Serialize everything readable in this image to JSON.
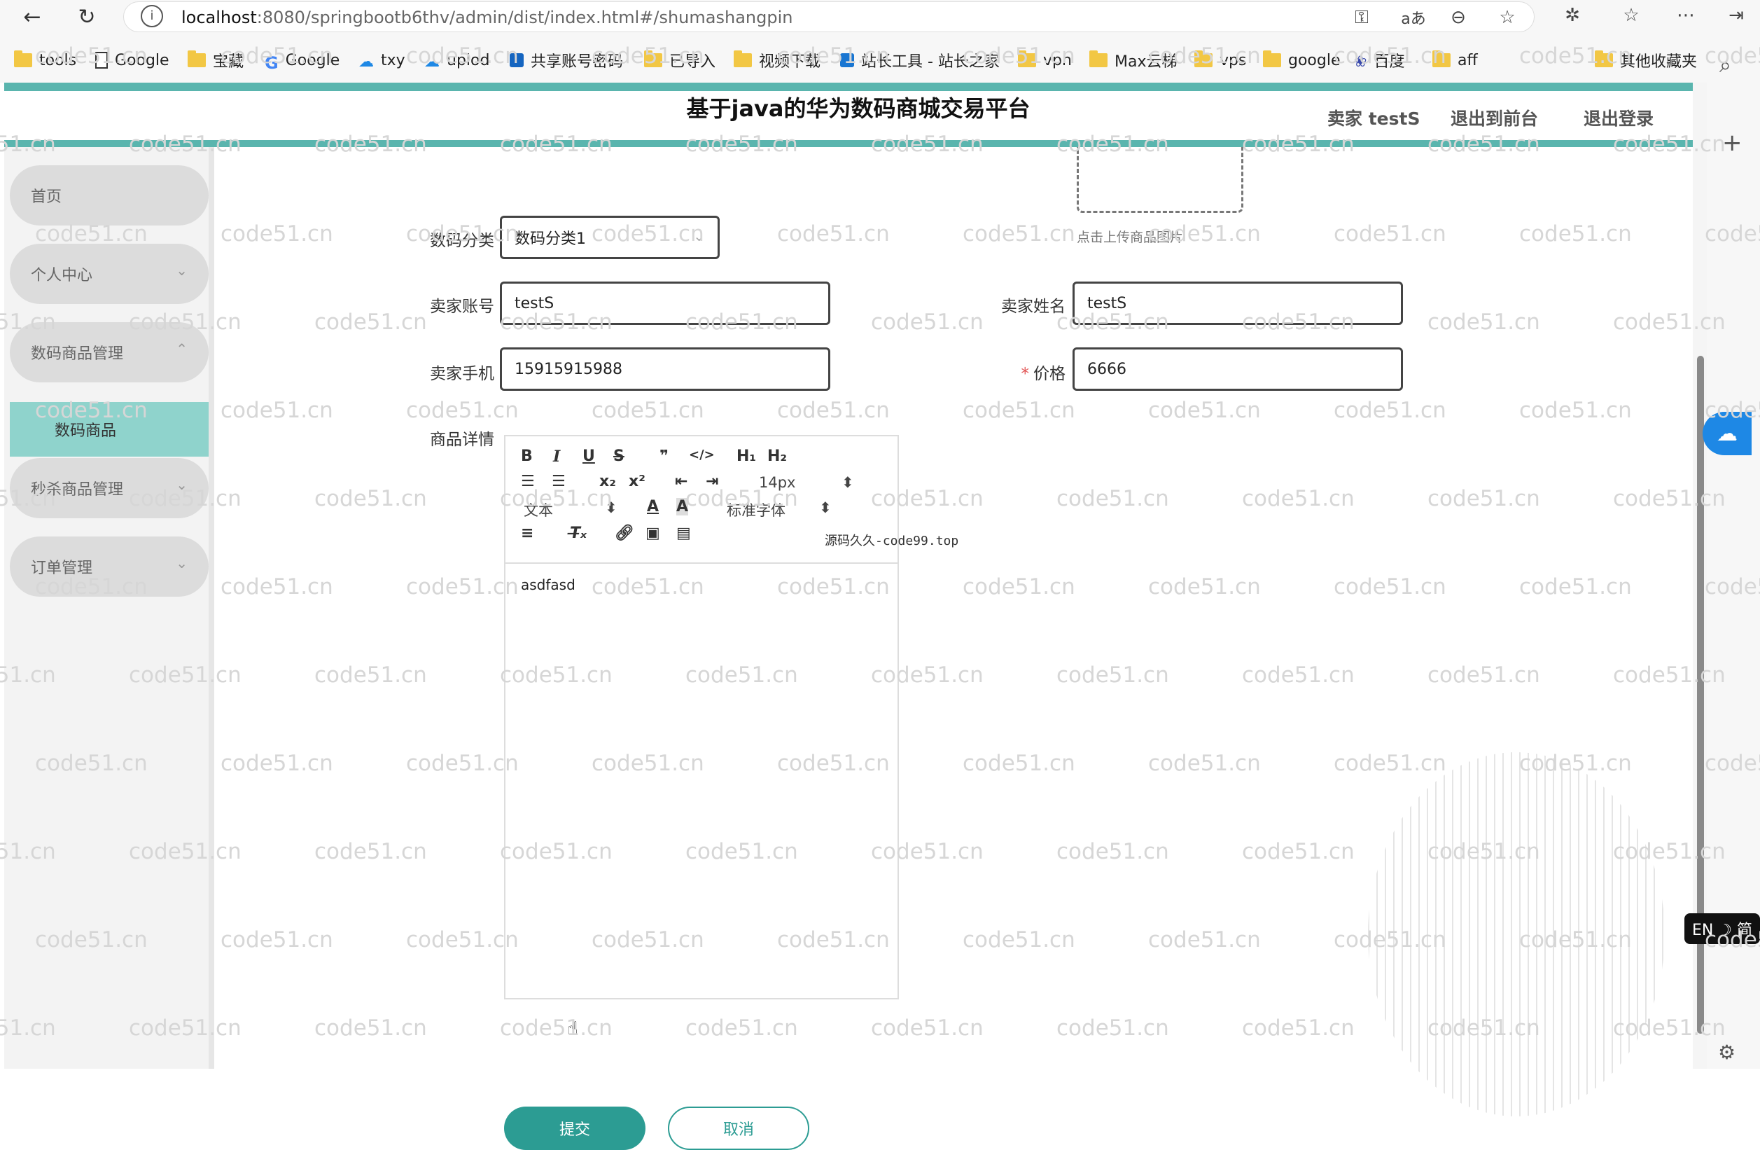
{
  "browser": {
    "url_host": "localhost",
    "url_path": ":8080/springbootb6thv/admin/dist/index.html#/shumashangpin",
    "bookmarks": [
      {
        "label": "tools",
        "icon": "folder-icon"
      },
      {
        "label": "Google",
        "icon": "page-icon"
      },
      {
        "label": "宝藏",
        "icon": "folder-icon"
      },
      {
        "label": "Google",
        "icon": "google-icon"
      },
      {
        "label": "txy",
        "icon": "cloud-icon"
      },
      {
        "label": "uplod",
        "icon": "baidu-cloud-icon"
      },
      {
        "label": "共享账号密码",
        "icon": "app-icon"
      },
      {
        "label": "已导入",
        "icon": "folder-icon"
      },
      {
        "label": "视频下载",
        "icon": "folder-icon"
      },
      {
        "label": "站长工具 - 站长之家",
        "icon": "site-icon"
      },
      {
        "label": "vpn",
        "icon": "folder-icon"
      },
      {
        "label": "Max云梯",
        "icon": "folder-icon"
      },
      {
        "label": "vps",
        "icon": "folder-icon"
      },
      {
        "label": "google",
        "icon": "folder-icon"
      },
      {
        "label": "百度",
        "icon": "baidu-icon"
      },
      {
        "label": "aff",
        "icon": "folder-icon"
      },
      {
        "label": "其他收藏夹",
        "icon": "folder-icon"
      }
    ]
  },
  "header": {
    "title": "基于java的华为数码商城交易平台",
    "user": "卖家 testS",
    "front_link": "退出到前台",
    "logout_link": "退出登录"
  },
  "sidebar": {
    "items": [
      {
        "label": "首页"
      },
      {
        "label": "个人中心"
      },
      {
        "label": "数码商品管理"
      },
      {
        "label": "秒杀商品管理"
      },
      {
        "label": "订单管理"
      }
    ],
    "sub_item": "数码商品"
  },
  "form": {
    "upload_hint": "点击上传商品图片",
    "category_label": "数码分类",
    "category_value": "数码分类1",
    "seller_account_label": "卖家账号",
    "seller_account_value": "testS",
    "seller_name_label": "卖家姓名",
    "seller_name_value": "testS",
    "seller_phone_label": "卖家手机",
    "seller_phone_value": "15915915988",
    "price_required": "*",
    "price_label": "价格",
    "price_value": "6666",
    "detail_label": "商品详情",
    "editor": {
      "font_size": "14px",
      "text_style": "文本",
      "font_family": "标准字体",
      "content": "asdfasd"
    },
    "submit": "提交",
    "cancel": "取消"
  },
  "overlay_note": "源码久久-code99.top",
  "watermark": "code51.cn",
  "ime_label": "EN ☽ 简",
  "colors": {
    "accent": "#5ab5ae",
    "submenu_bg": "#8fd3cc",
    "button": "#2c9c93"
  }
}
